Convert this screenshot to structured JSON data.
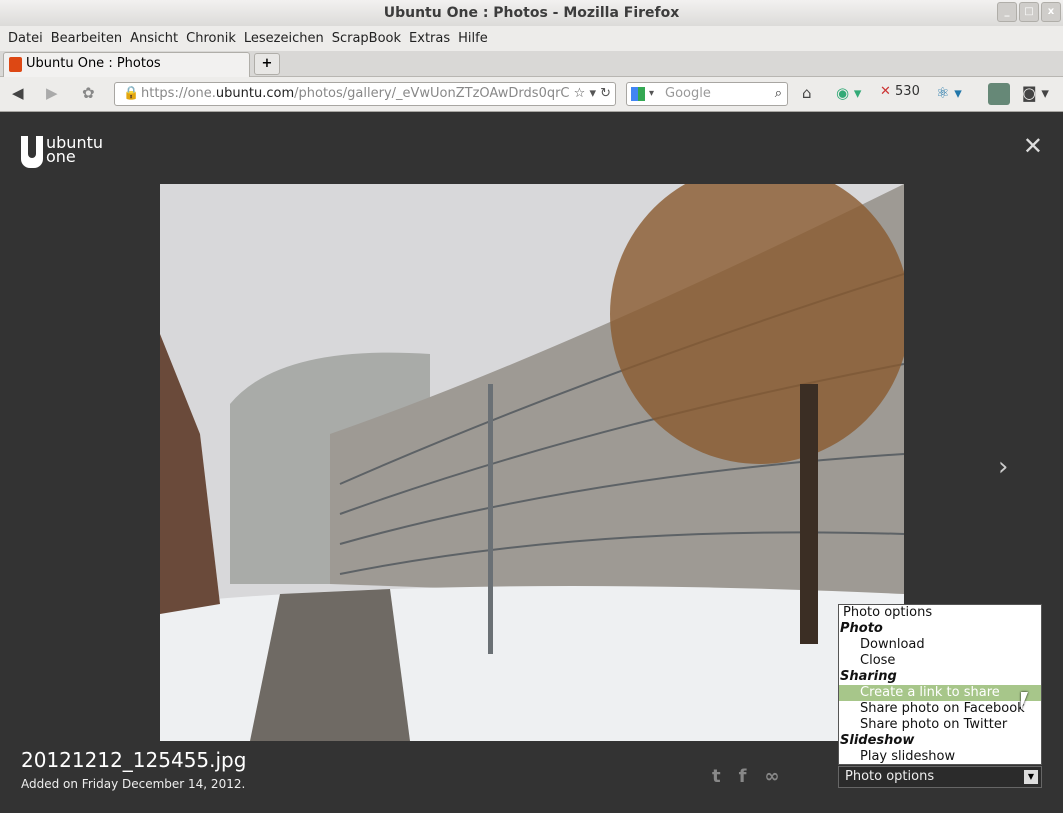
{
  "window": {
    "title": "Ubuntu One : Photos - Mozilla Firefox"
  },
  "menu": [
    "Datei",
    "Bearbeiten",
    "Ansicht",
    "Chronik",
    "Lesezeichen",
    "ScrapBook",
    "Extras",
    "Hilfe"
  ],
  "tab": {
    "title": "Ubuntu One : Photos",
    "new_tab": "+"
  },
  "nav": {
    "url_prefix": "https://one.",
    "url_domain": "ubuntu.com",
    "url_rest": "/photos/gallery/_eVwUonZTzOAwDrds0qrC",
    "search_placeholder": "Google",
    "counter": "530"
  },
  "page": {
    "logo_line1": "ubuntu",
    "logo_line2": "one",
    "close": "✕",
    "next": "›",
    "filename": "20121212_125455.jpg",
    "added": "Added on Friday December 14, 2012."
  },
  "options": {
    "header": "Photo options",
    "groups": [
      {
        "label": "Photo",
        "items": [
          "Download",
          "Close"
        ]
      },
      {
        "label": "Sharing",
        "items": [
          "Create a link to share",
          "Share photo on Facebook",
          "Share photo on Twitter"
        ]
      },
      {
        "label": "Slideshow",
        "items": [
          "Play slideshow"
        ]
      }
    ],
    "selected": "Photo options",
    "highlighted": "Create a link to share"
  },
  "share_icons": [
    "twitter-icon",
    "facebook-icon",
    "link-icon"
  ]
}
